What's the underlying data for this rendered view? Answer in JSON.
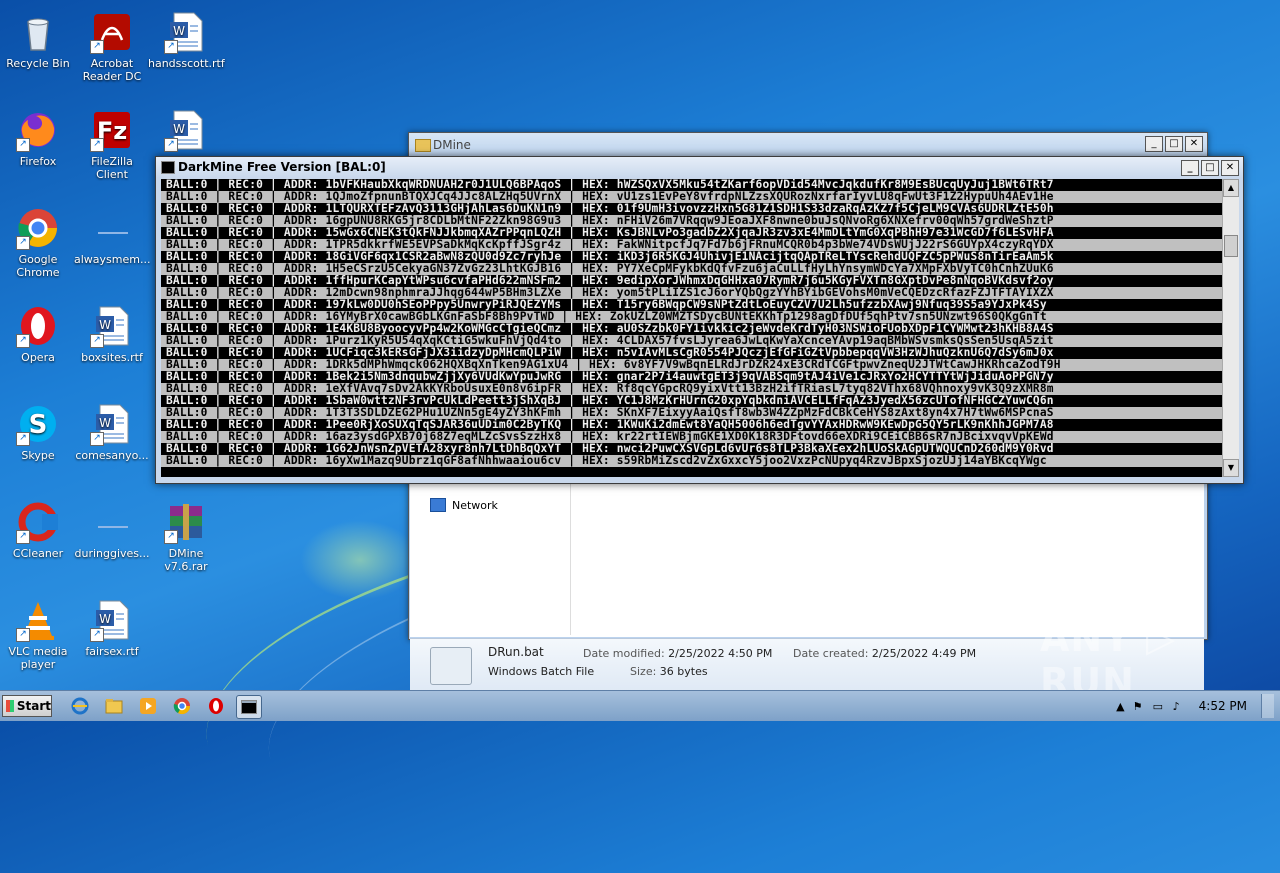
{
  "desktop_icons": [
    {
      "label": "Recycle Bin",
      "icon": "recycle-bin-icon"
    },
    {
      "label": "Acrobat Reader DC",
      "icon": "acrobat-icon"
    },
    {
      "label": "handsscott.rtf",
      "icon": "word-doc-icon"
    },
    {
      "label": "Firefox",
      "icon": "firefox-icon"
    },
    {
      "label": "FileZilla Client",
      "icon": "filezilla-icon"
    },
    {
      "label": "",
      "icon": "word-doc-icon"
    },
    {
      "label": "Google Chrome",
      "icon": "chrome-icon"
    },
    {
      "label": "alwaysmem...",
      "icon": "blank-doc-icon"
    },
    {
      "label": "Opera",
      "icon": "opera-icon"
    },
    {
      "label": "boxsites.rtf",
      "icon": "word-doc-icon"
    },
    {
      "label": "Skype",
      "icon": "skype-icon"
    },
    {
      "label": "comesanyo...",
      "icon": "word-doc-icon"
    },
    {
      "label": "CCleaner",
      "icon": "ccleaner-icon"
    },
    {
      "label": "duringgives...",
      "icon": "blank-doc-icon"
    },
    {
      "label": "DMine v7.6.rar",
      "icon": "winrar-icon"
    },
    {
      "label": "VLC media player",
      "icon": "vlc-icon"
    },
    {
      "label": "fairsex.rtf",
      "icon": "word-doc-icon"
    }
  ],
  "explorer": {
    "title": "DMine",
    "nav_network": "Network",
    "file_name": "DRun.bat",
    "file_type": "Windows Batch File",
    "date_modified_label": "Date modified:",
    "date_modified": "2/25/2022 4:50 PM",
    "date_created_label": "Date created:",
    "date_created": "2/25/2022 4:49 PM",
    "size_label": "Size:",
    "size": "36 bytes"
  },
  "console": {
    "title": "DarkMine Free Version [BAL:0]",
    "lines": [
      "BALL:0 | REC:0 | ADDR: 1bVFKHaubXkqWRDNUAH2r0J1ULQ6BPAqoS | HEX: hWZSQxVX5Mku54tZKarf6opVDid54MvcJqkdufKr8M9EsBUcqUyJuj1BWt6TRt7",
      "BALL:0 | REC:0 | ADDR: 1QJmoZfpnunBTQXJCq4JJc8ALZHq5UVrnX | HEX: vU1zs1EvPeY8vfrdpNLZzsXQURozNxrfarIyvLU8qFwUt3F1Z2HypuUh4AEv1He",
      "BALL:0 | REC:0 | ADDR: 1LTQURXTEFzAvQ3113GHjAhLas6DuKN1n9 | HEX: 01f9UmH3ivovzzHxn5G81Z1SDH1S33dzaRqAzKZ7f5CjeLM9CVAs6UDRLZtE50h",
      "BALL:0 | REC:0 | ADDR: 16gpUNU8RKG5jr8CDLbMtNF22Zkn98G9u3 | HEX: nFHiV26m7VRqqw9JEoaJXF8nwne0buJsQNvoRg6XNXefrv00qWh57grdWeShztP",
      "BALL:0 | REC:0 | ADDR: 15wGx6CNEK3tQkFNJJkbmqXAZrPPqnLQZH | HEX: KsJBNLvPo3gadbZ2XjqaJR3zv3xE4MmDLtYmG0XqPBhH97e31WcGD7f6LESvHFA",
      "BALL:0 | REC:0 | ADDR: 1TPR5dkkrfWE5EVPSaDkMqKcKpffJSgr4z | HEX: FakWNitpcfJq7Fd7b6jFRnuMCQR0b4p3bWe74VDsWUjJ22rS6GUYpX4czyRqYDX",
      "BALL:0 | REC:0 | ADDR: 18GiVGF6qx1CSR2aBwN8zQU0d9Zc7ryhJe | HEX: iKD3j6R5KGJ4UhivjE1NAcijtqQApTReLTYscRehdUQFZC5pPWuS8nTirEaAm5k",
      "BALL:0 | REC:0 | ADDR: 1H5eCSrzU5CekyaGN37ZvGz23LhtKGJB16 | HEX: PY7XeCpMFykbKdQfvFzu6jaCuLLfHyLhYnsymWDcYa7XMpFXbVyTC0hCnhZUuK6",
      "BALL:0 | REC:0 | ADDR: 1ffHpurKCapYtWPsu6cvfaPHd622mNSFm2 | HEX: 9edipXorJWhmxDqGHHxa07RymR7j6u5KGyFVXTn8GXptDvPe8nNqoBVKdsvf2oy",
      "BALL:0 | REC:0 | ADDR: 12mDcwn98nphmraJJhqg644wP5BHm3LZXe | HEX: yom5tPLiIZS1cJ6orYQbQgzYYhBYibGEVohsM0mVeCQEDzcRfazFZJTFTAYIXZX",
      "BALL:0 | REC:0 | ADDR: 197kLw0DU0hSEoPPpy5UnwryPiRJQEZYMs | HEX: T15ry6BWqpCW9sNPtZdtLoEuyCZV7U2Lh5ufzzbXAwj9Nfuq39S5a9YJxPk4Sy",
      "BALL:0 | REC:0 | ADDR: 16YMyBrX0cawBGbLKGnFaSbF8Bh9PvTWD | HEX: ZokUZLZ0WMZTSDycBUNtEKKhTp1298agDfDUf5qhPtv7sn5UNzwt96S0QKgGnTt",
      "BALL:0 | REC:0 | ADDR: 1E4KBU8ByoocyvPp4w2KoWMGcCTgieQCmz | HEX: aU0SZzbk0FY1ivkkic2jeWvdeKrdTyH03NSWioFUobXDpF1CYWMwt23hKHB8A4S",
      "BALL:0 | REC:0 | ADDR: 1Purz1KyR5U54qXqKCtiG5wkuFhVjQd4to | HEX: 4CLDAX57fvsLJyrea6JwLqKwYaXcnceYAvp19aqBMbWSvsmksQsSen5UsqA5zit",
      "BALL:0 | REC:0 | ADDR: 1UCFiqc3kERsGFjJX3iidzyDpMHcmQLPiW | HEX: n5vIAvMLsCgR0554PJQczjEfGFiGZtVpbbepqqVW3HzWJhuQzknU6Q7dSy6mJ0x",
      "BALL:0 | REC:0 | ADDR: 1DRk5dMPhWmqck062HQXBqXnTken9AG1xU4 | HEX: 6v8YF7V9wBqnELRdJrDZR24xE3CRdTCGFtpwvZneqU2JTWtCawJHKRhcaZodT9H",
      "BALL:0 | REC:0 | ADDR: 1Bek2i5Nm3dnqubwZjjXy6VUdKwYpuJwRG | HEX: gnar2P7i4auwtgET3j9qVABSqm9tAJ4iVe1cJRxYo2HCYTTYtWjJiduAoPPGN7y",
      "BALL:0 | REC:0 | ADDR: 1eXfVAvq7sDv2AkKYRboUsuxE0n8v6ipFR | HEX: Rf8qcYGpcRQ9yixVtt13BzH2ifTRiasL7tyq82VThx68VQhnoxy9vK3Q9zXMR8m",
      "BALL:0 | REC:0 | ADDR: 1SbaW0wttzNF3rvPcUkLdPeett3jShXqBJ | HEX: YC1J8MzKrHUrnG20xpYqbkdniAVCELLfFqAZ3JyedX56zcUTofNFHGCZYuwCQ6n",
      "BALL:0 | REC:0 | ADDR: 1T3T3SDLDZEG2PHu1UZNn5gE4yZY3hKFmh | HEX: SKnXF7EixyyAaiQsfT8wb3W4ZZpMzFdCBkCeHYS8zAxt8yn4x7H7tWw6MSPcnaS",
      "BALL:0 | REC:0 | ADDR: 1Pee0RjXoSUXqTqSJAR36uUDim0C2ByTKQ | HEX: 1KWuKi2dmEwt8YaQH5006h6edTgvYYAxHDRwW9KEwDpG5QY5rLK9nKhhJGPM7A8",
      "BALL:0 | REC:0 | ADDR: 16az3ysdGPXB70j68Z7eqMLZcSvsSzzHx8 | HEX: kr22rtIEWBjmGKE1XD0K18R3DFtovd66eXDRi9CEiCBB6sR7nJBcixvqvVpKEWd",
      "BALL:0 | REC:0 | ADDR: 1G62JnWsnZpVETA28xyr8nh7LtDhBqQxYT | HEX: nwci2PuwCXSVGpLd6vUr6s8TLP3BkaXEex2hLUoSkAGpUTWQUCnD260dM9Y0Rvd",
      "BALL:0 | REC:0 | ADDR: 16yXw1Mazq9Ubrz1qGF8afNhhwaaiou6cv | HEX: s59RbMiZscd2vZxGxxcY5joo2VxzPcNUpyq4RzvJBpxSjozUJj14aYBKcqYWgc"
    ]
  },
  "taskbar": {
    "start_label": "Start",
    "clock": "4:52 PM",
    "items": [
      "ie-icon",
      "explorer-icon",
      "media-player-icon",
      "chrome-icon",
      "opera-icon",
      "console-icon"
    ]
  },
  "watermark": "ANY ▷ RUN",
  "colors": {
    "accent": "#1d7fd6",
    "console_bg": "#000000",
    "console_alt": "#c0c0c0"
  }
}
